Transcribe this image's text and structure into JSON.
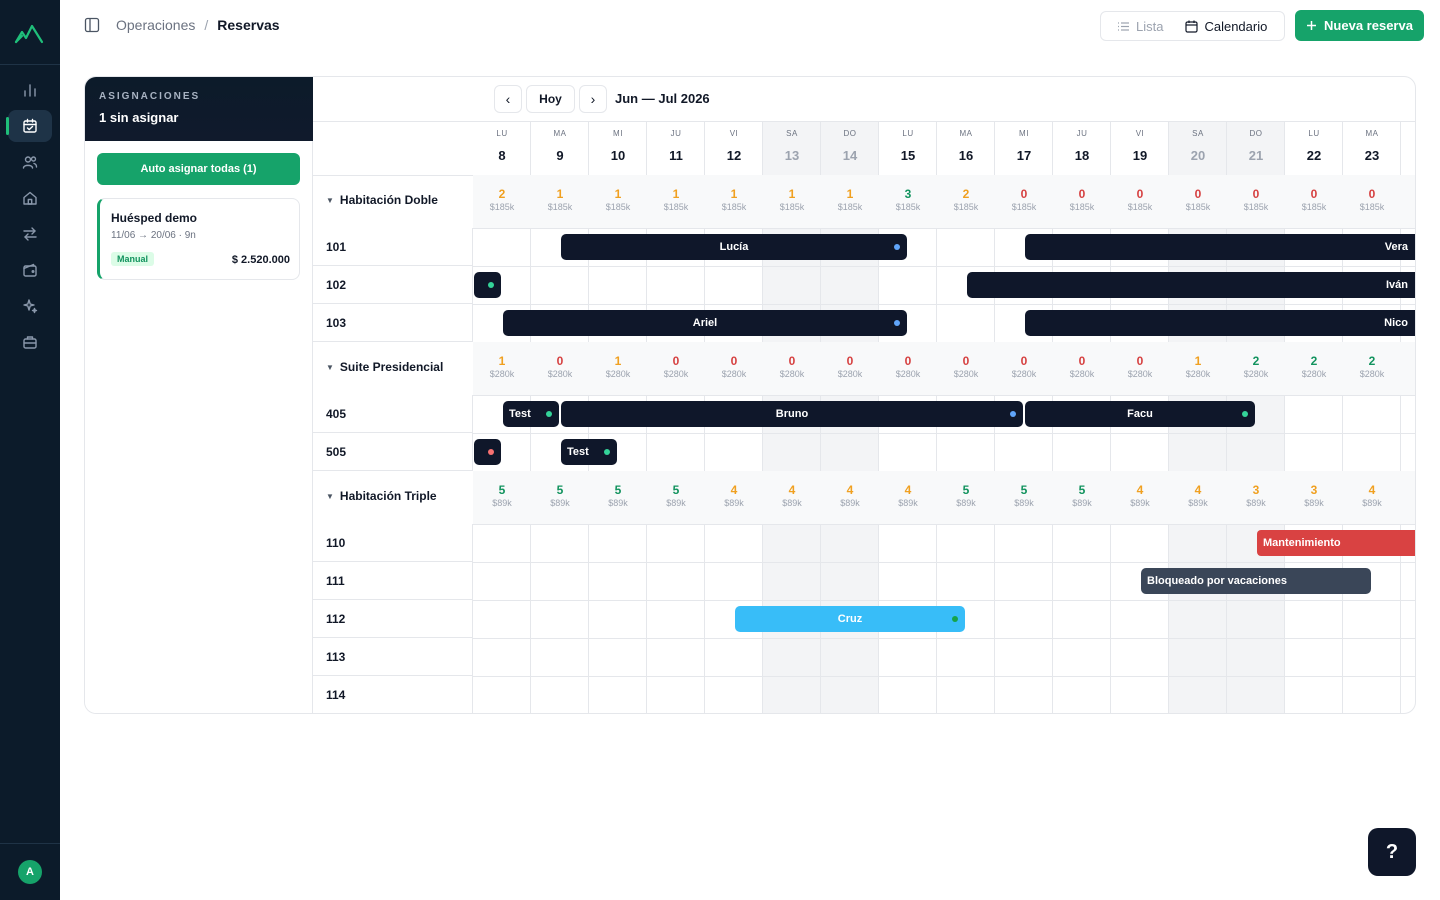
{
  "app": {
    "avatar_initial": "A"
  },
  "sidebar": {
    "items": [
      {
        "icon": "bar-chart-icon",
        "active": false
      },
      {
        "icon": "calendar-check-icon",
        "active": true
      },
      {
        "icon": "users-icon",
        "active": false
      },
      {
        "icon": "home-icon",
        "active": false
      },
      {
        "icon": "swap-arrows-icon",
        "active": false
      },
      {
        "icon": "wallet-icon",
        "active": false
      },
      {
        "icon": "sparkles-icon",
        "active": false
      },
      {
        "icon": "briefcase-icon",
        "active": false
      }
    ]
  },
  "breadcrumb": {
    "parent": "Operaciones",
    "separator": "/",
    "current": "Reservas"
  },
  "view_toggle": {
    "lista": "Lista",
    "calendario": "Calendario"
  },
  "new_button": {
    "label": "Nueva reserva"
  },
  "assign": {
    "kicker": "ASIGNACIONES",
    "title": "1 sin asignar",
    "auto_button": "Auto asignar todas (1)",
    "card": {
      "name": "Huésped demo",
      "dates": "11/06 → 20/06 · 9n",
      "badge": "Manual",
      "price": "$ 2.520.000"
    }
  },
  "calendar": {
    "prev": "‹",
    "today": "Hoy",
    "next": "›",
    "range": "Jun — Jul 2026",
    "days": [
      {
        "dow": "LU",
        "num": "8",
        "weekend": false
      },
      {
        "dow": "MA",
        "num": "9",
        "weekend": false
      },
      {
        "dow": "MI",
        "num": "10",
        "weekend": false
      },
      {
        "dow": "JU",
        "num": "11",
        "weekend": false
      },
      {
        "dow": "VI",
        "num": "12",
        "weekend": false
      },
      {
        "dow": "SA",
        "num": "13",
        "weekend": true
      },
      {
        "dow": "DO",
        "num": "14",
        "weekend": true
      },
      {
        "dow": "LU",
        "num": "15",
        "weekend": false
      },
      {
        "dow": "MA",
        "num": "16",
        "weekend": false
      },
      {
        "dow": "MI",
        "num": "17",
        "weekend": false
      },
      {
        "dow": "JU",
        "num": "18",
        "weekend": false
      },
      {
        "dow": "VI",
        "num": "19",
        "weekend": false
      },
      {
        "dow": "SA",
        "num": "20",
        "weekend": true
      },
      {
        "dow": "DO",
        "num": "21",
        "weekend": true
      },
      {
        "dow": "LU",
        "num": "22",
        "weekend": false
      },
      {
        "dow": "MA",
        "num": "23",
        "weekend": false
      }
    ],
    "categories": [
      {
        "name": "Habitación Doble",
        "price": "$185k",
        "availability": [
          2,
          1,
          1,
          1,
          1,
          1,
          1,
          3,
          2,
          0,
          0,
          0,
          0,
          0,
          0,
          0
        ],
        "rooms": [
          "101",
          "102",
          "103"
        ]
      },
      {
        "name": "Suite Presidencial",
        "price": "$280k",
        "availability": [
          1,
          0,
          1,
          0,
          0,
          0,
          0,
          0,
          0,
          0,
          0,
          0,
          1,
          2,
          2,
          2
        ],
        "rooms": [
          "405",
          "505"
        ]
      },
      {
        "name": "Habitación Triple",
        "price": "$89k",
        "availability": [
          5,
          5,
          5,
          5,
          4,
          4,
          4,
          4,
          5,
          5,
          5,
          4,
          4,
          3,
          3,
          4
        ],
        "rooms": [
          "110",
          "111",
          "112",
          "113",
          "114"
        ]
      }
    ],
    "bookings": [
      {
        "room": "101",
        "label": "Lucía",
        "start": 1.5,
        "end": 7.5,
        "dot": "#60a5fa",
        "style": "dark",
        "align": "center"
      },
      {
        "room": "101",
        "label": "Vera",
        "start": 9.5,
        "end": 16.5,
        "dot": "",
        "style": "dark",
        "align": "right"
      },
      {
        "room": "102",
        "label": "",
        "start": 0,
        "end": 0.5,
        "dot": "#34d399",
        "style": "dark",
        "align": "center"
      },
      {
        "room": "102",
        "label": "Iván",
        "start": 8.5,
        "end": 16.5,
        "dot": "",
        "style": "dark",
        "align": "right"
      },
      {
        "room": "103",
        "label": "Ariel",
        "start": 0.5,
        "end": 7.5,
        "dot": "#60a5fa",
        "style": "dark",
        "align": "center"
      },
      {
        "room": "103",
        "label": "Nico",
        "start": 9.5,
        "end": 16.5,
        "dot": "",
        "style": "dark",
        "align": "right"
      },
      {
        "room": "405",
        "label": "Test",
        "start": 0.5,
        "end": 1.5,
        "dot": "#34d399",
        "style": "dark",
        "align": "left"
      },
      {
        "room": "405",
        "label": "Bruno",
        "start": 1.5,
        "end": 9.5,
        "dot": "#60a5fa",
        "style": "dark",
        "align": "center"
      },
      {
        "room": "405",
        "label": "Facu",
        "start": 9.5,
        "end": 13.5,
        "dot": "#34d399",
        "style": "dark",
        "align": "center"
      },
      {
        "room": "505",
        "label": "",
        "start": 0,
        "end": 0.5,
        "dot": "#f87171",
        "style": "dark",
        "align": "center"
      },
      {
        "room": "505",
        "label": "Test",
        "start": 1.5,
        "end": 2.5,
        "dot": "#34d399",
        "style": "dark",
        "align": "left"
      },
      {
        "room": "110",
        "label": "Mantenimiento",
        "start": 13.5,
        "end": 16.5,
        "dot": "",
        "style": "maint",
        "align": "left"
      },
      {
        "room": "111",
        "label": "Bloqueado por vacaciones",
        "start": 11.5,
        "end": 15.5,
        "dot": "",
        "style": "vac",
        "align": "left"
      },
      {
        "room": "112",
        "label": "Cruz",
        "start": 4.5,
        "end": 8.5,
        "dot": "#16a34a",
        "style": "cruz",
        "align": "center"
      }
    ]
  },
  "colors": {
    "accent": "#16a36a",
    "sidebar": "#0c1b2a",
    "booking": "#0f172a",
    "maintenance": "#d94242",
    "blocked": "#3a4658",
    "cruz": "#38bdf8"
  },
  "help_button": {
    "label": "?"
  }
}
